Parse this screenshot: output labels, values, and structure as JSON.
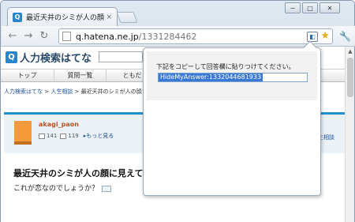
{
  "browser": {
    "tab_title": "最近天井のシミが人の顔",
    "tab_close": "×",
    "favicon_letter": "Q",
    "url_host": "q.hatena.ne.jp",
    "url_path": "/1331284462",
    "window_controls": {
      "minimize": "−",
      "maximize": "□",
      "close": "✕"
    },
    "icons": {
      "back": "back-arrow-icon",
      "forward": "forward-arrow-icon",
      "reload": "reload-icon",
      "star": "star-icon",
      "wrench": "wrench-icon",
      "extension": "extension-icon"
    }
  },
  "site": {
    "logo_text": "人力検索はてな",
    "nav": [
      "トップ",
      "質問一覧",
      "ともだ"
    ],
    "breadcrumb": {
      "home": "人力検索はてな",
      "sep1": " > ",
      "category": "人生相談",
      "sep2": " > ",
      "current": "最近天井のシミが人の顔"
    },
    "user": {
      "name": "akagi_paon",
      "stat1": "141",
      "stat2": "119",
      "more": "▸もっと見る",
      "side_link": "生相談"
    },
    "question_title": "最近天井のシミが人の顔に見えて",
    "question_body": "これが恋なのでしょうか？"
  },
  "popup": {
    "message": "下記をコピーして回答欄に貼りつけてください。",
    "field_value": "HideMyAnswer:1332044681933"
  },
  "colors": {
    "accent": "#2a86c8",
    "link": "#1a4fa0",
    "selection": "#3a78d6",
    "user_name": "#c0501a"
  }
}
